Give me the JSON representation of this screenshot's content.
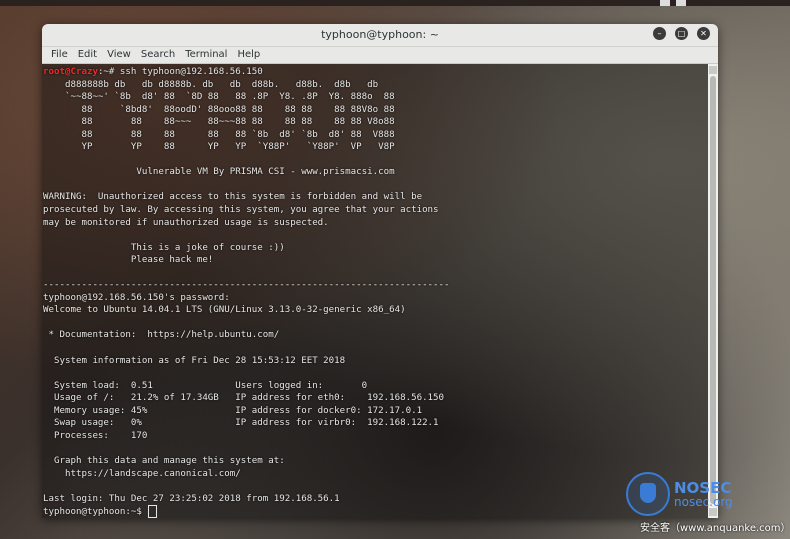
{
  "window": {
    "title": "typhoon@typhoon: ~",
    "buttons": [
      "–",
      "□",
      "✕"
    ]
  },
  "menubar": [
    "File",
    "Edit",
    "View",
    "Search",
    "Terminal",
    "Help"
  ],
  "terminal": {
    "prompt_user": "root@Crazy",
    "prompt_rest": ":~# ssh typhoon@192.168.56.150",
    "lines": [
      "    d888888b db   db d8888b. db   db  d88b.   d88b.  d8b   db",
      "    `~~88~~' `8b  d8' 88  `8D 88   88 .8P  Y8. .8P  Y8. 888o  88",
      "       88     `8bd8'  88oodD' 88ooo88 88    88 88    88 88V8o 88",
      "       88       88    88~~~   88~~~88 88    88 88    88 88 V8o88",
      "       88       88    88      88   88 `8b  d8' `8b  d8' 88  V888",
      "       YP       YP    88      YP   YP  `Y88P'   `Y88P'  VP   V8P",
      "",
      "                 Vulnerable VM By PRISMA CSI - www.prismacsi.com",
      "",
      "WARNING:  Unauthorized access to this system is forbidden and will be",
      "prosecuted by law. By accessing this system, you agree that your actions",
      "may be monitored if unauthorized usage is suspected.",
      "",
      "                This is a joke of course :))",
      "                Please hack me!",
      "",
      "--------------------------------------------------------------------------",
      "typhoon@192.168.56.150's password:",
      "Welcome to Ubuntu 14.04.1 LTS (GNU/Linux 3.13.0-32-generic x86_64)",
      "",
      " * Documentation:  https://help.ubuntu.com/",
      "",
      "  System information as of Fri Dec 28 15:53:12 EET 2018",
      "",
      "  System load:  0.51               Users logged in:       0",
      "  Usage of /:   21.2% of 17.34GB   IP address for eth0:    192.168.56.150",
      "  Memory usage: 45%                IP address for docker0: 172.17.0.1",
      "  Swap usage:   0%                 IP address for virbr0:  192.168.122.1",
      "  Processes:    170",
      "",
      "  Graph this data and manage this system at:",
      "    https://landscape.canonical.com/",
      "",
      "Last login: Thu Dec 27 23:25:02 2018 from 192.168.56.1"
    ],
    "final_prompt": "typhoon@typhoon:~$ "
  },
  "watermark": {
    "brand": "NOSEC",
    "sub": "nosec.org",
    "caption": "安全客（www.anquanke.com）"
  }
}
